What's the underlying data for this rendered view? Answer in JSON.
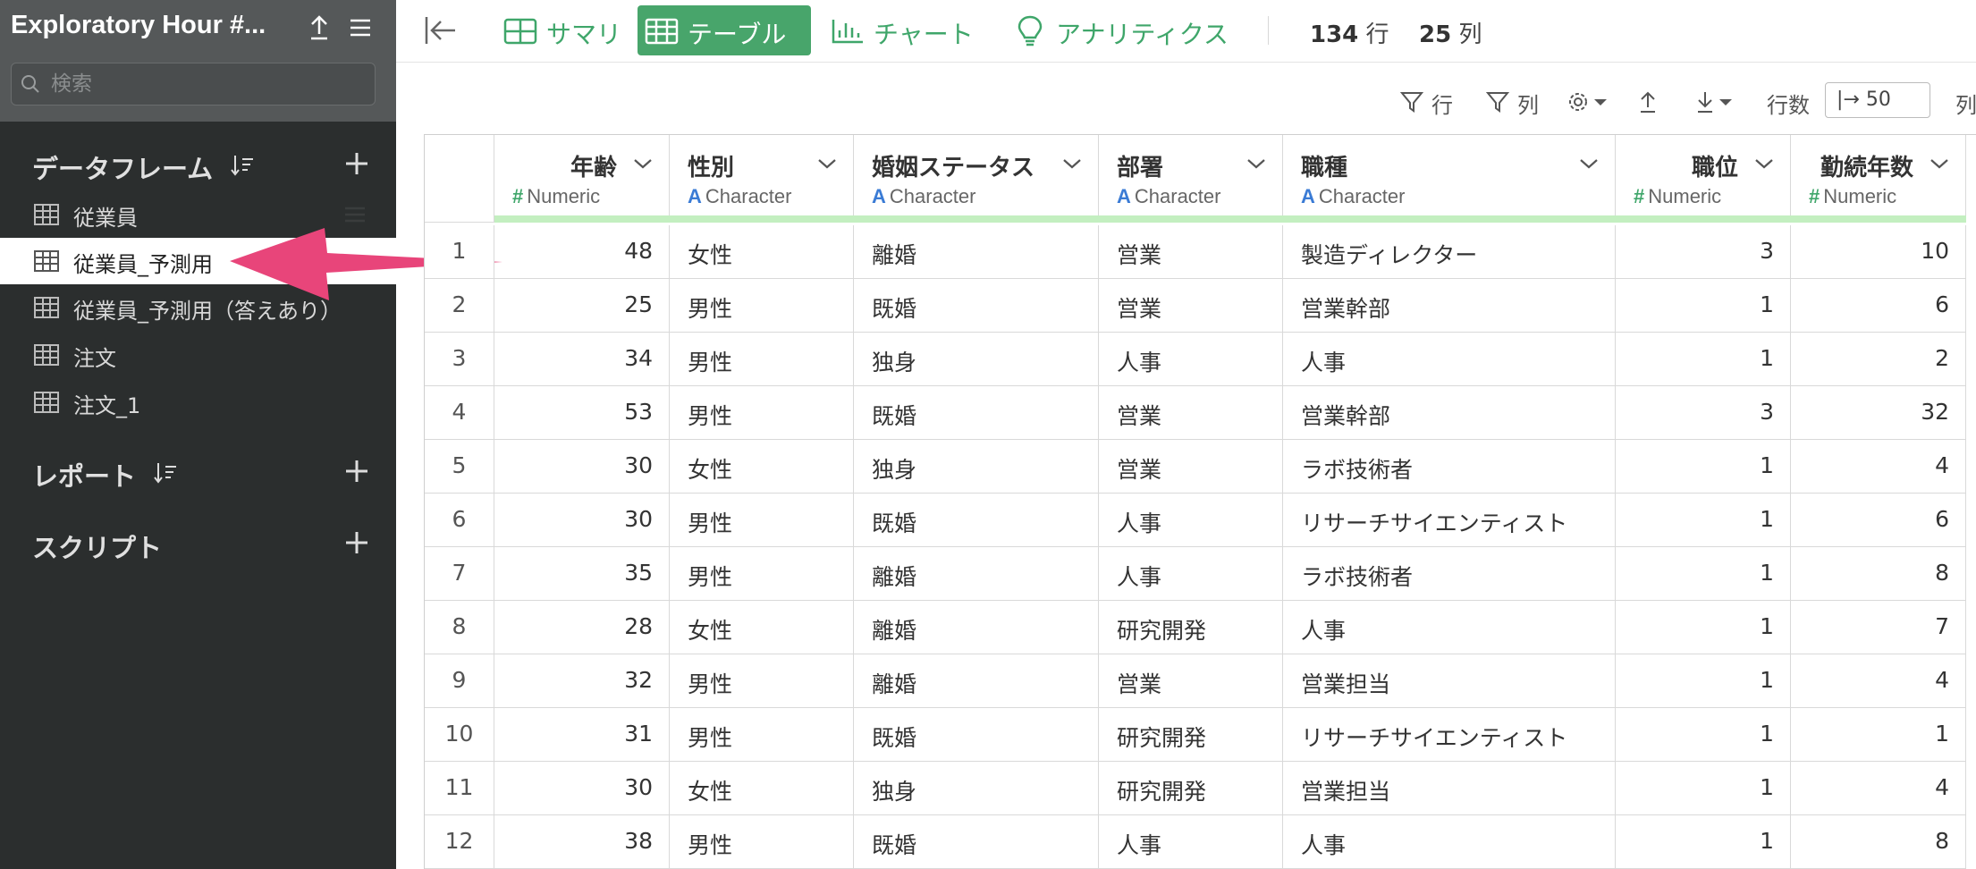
{
  "sidebar": {
    "project_title": "Exploratory Hour #...",
    "search_placeholder": "検索",
    "sections": {
      "dataframes": "データフレーム",
      "reports": "レポート",
      "scripts": "スクリプト"
    },
    "dataframe_items": [
      {
        "label": "従業員"
      },
      {
        "label": "従業員_予測用"
      },
      {
        "label": "従業員_予測用（答えあり）"
      },
      {
        "label": "注文"
      },
      {
        "label": "注文_1"
      }
    ],
    "selected_item": "従業員_予測用"
  },
  "toolbar": {
    "tabs": [
      {
        "label": "サマリ",
        "icon": "summary-grid-icon"
      },
      {
        "label": "テーブル",
        "icon": "table-icon"
      },
      {
        "label": "チャート",
        "icon": "bar-chart-icon"
      },
      {
        "label": "アナリティクス",
        "icon": "lightbulb-icon"
      }
    ],
    "active_tab": "テーブル",
    "row_count": "134",
    "row_unit": "行",
    "col_count": "25",
    "col_unit": "列"
  },
  "subbar": {
    "filter_rows": "行",
    "filter_cols": "列",
    "rows_label": "行数",
    "rows_value": "|→ 50",
    "cols_label": "列"
  },
  "table": {
    "columns": [
      {
        "name": "年齢",
        "type": "Numeric",
        "kind": "num"
      },
      {
        "name": "性別",
        "type": "Character",
        "kind": "chr"
      },
      {
        "name": "婚姻ステータス",
        "type": "Character",
        "kind": "chr"
      },
      {
        "name": "部署",
        "type": "Character",
        "kind": "chr"
      },
      {
        "name": "職種",
        "type": "Character",
        "kind": "chr"
      },
      {
        "name": "職位",
        "type": "Numeric",
        "kind": "num"
      },
      {
        "name": "勤続年数",
        "type": "Numeric",
        "kind": "num"
      }
    ],
    "rows": [
      [
        "1",
        "48",
        "女性",
        "離婚",
        "営業",
        "製造ディレクター",
        "3",
        "10"
      ],
      [
        "2",
        "25",
        "男性",
        "既婚",
        "営業",
        "営業幹部",
        "1",
        "6"
      ],
      [
        "3",
        "34",
        "男性",
        "独身",
        "人事",
        "人事",
        "1",
        "2"
      ],
      [
        "4",
        "53",
        "男性",
        "既婚",
        "営業",
        "営業幹部",
        "3",
        "32"
      ],
      [
        "5",
        "30",
        "女性",
        "独身",
        "営業",
        "ラボ技術者",
        "1",
        "4"
      ],
      [
        "6",
        "30",
        "男性",
        "既婚",
        "人事",
        "リサーチサイエンティスト",
        "1",
        "6"
      ],
      [
        "7",
        "35",
        "男性",
        "離婚",
        "人事",
        "ラボ技術者",
        "1",
        "8"
      ],
      [
        "8",
        "28",
        "女性",
        "離婚",
        "研究開発",
        "人事",
        "1",
        "7"
      ],
      [
        "9",
        "32",
        "男性",
        "離婚",
        "営業",
        "営業担当",
        "1",
        "4"
      ],
      [
        "10",
        "31",
        "男性",
        "既婚",
        "研究開発",
        "リサーチサイエンティスト",
        "1",
        "1"
      ],
      [
        "11",
        "30",
        "女性",
        "独身",
        "研究開発",
        "営業担当",
        "1",
        "4"
      ],
      [
        "12",
        "38",
        "男性",
        "既婚",
        "人事",
        "人事",
        "1",
        "8"
      ]
    ]
  },
  "colors": {
    "accent_green": "#48a56b",
    "sidebar_bg": "#2b2e2e",
    "arrow_pink": "#e8457a",
    "numeric_mark": "#3fa66a",
    "character_mark": "#3a7bd5"
  }
}
